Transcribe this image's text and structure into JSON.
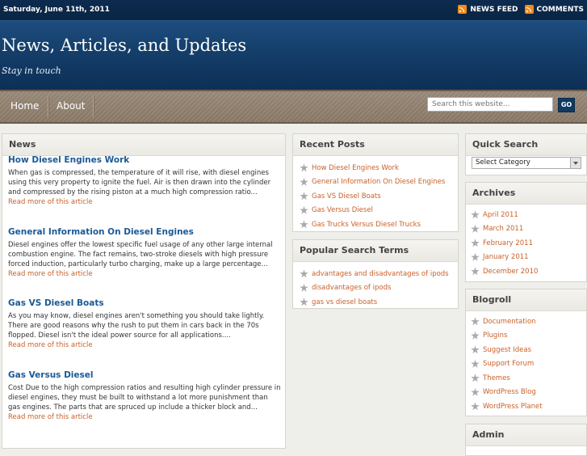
{
  "topbar": {
    "date": "Saturday, June 11th, 2011",
    "feeds": [
      "NEWS FEED",
      "COMMENTS"
    ]
  },
  "header": {
    "title": "News, Articles, and Updates",
    "tagline": "Stay in touch"
  },
  "nav": {
    "items": [
      "Home",
      "About"
    ],
    "search_placeholder": "Search this website...",
    "go_label": "GO"
  },
  "news": {
    "heading": "News",
    "posts": [
      {
        "title": "How Diesel Engines Work",
        "excerpt": "When gas is compressed, the temperature of it will rise, with diesel engines using this very property to ignite the fuel. Air is then drawn into the cylinder and compressed by the rising piston at a much high compression ratio...",
        "more": "Read more of this article"
      },
      {
        "title": "General Information On Diesel Engines",
        "excerpt": "Diesel engines offer the lowest specific fuel usage of any other large internal combustion engine. The fact remains, two-stroke diesels with high pressure forced induction, particularly turbo charging, make up a large percentage...",
        "more": "Read more of this article"
      },
      {
        "title": "Gas VS Diesel Boats",
        "excerpt": "As you may know, diesel engines aren't something you should take lightly. There are good reasons why the rush to put them in cars back in the 70s flopped. Diesel isn't the ideal power source for all applications....",
        "more": "Read more of this article"
      },
      {
        "title": "Gas Versus Diesel",
        "excerpt": "Cost Due to the high compression ratios and resulting high cylinder pressure in diesel engines, they must be built to withstand a lot more punishment than gas engines. The parts that are spruced up include a thicker block and...",
        "more": "Read more of this article"
      }
    ]
  },
  "recent": {
    "heading": "Recent Posts",
    "items": [
      "How Diesel Engines Work",
      "General Information On Diesel Engines",
      "Gas VS Diesel Boats",
      "Gas Versus Diesel",
      "Gas Trucks Versus Diesel Trucks"
    ]
  },
  "popular": {
    "heading": "Popular Search Terms",
    "items": [
      "advantages and disadvantages of ipods",
      "disadvantages of ipods",
      "gas vs diesel boats"
    ]
  },
  "quick": {
    "heading": "Quick Search",
    "select_value": "Select Category"
  },
  "archives": {
    "heading": "Archives",
    "items": [
      "April 2011",
      "March 2011",
      "February 2011",
      "January 2011",
      "December 2010"
    ]
  },
  "blogroll": {
    "heading": "Blogroll",
    "items": [
      "Documentation",
      "Plugins",
      "Suggest Ideas",
      "Support Forum",
      "Themes",
      "WordPress Blog",
      "WordPress Planet"
    ]
  },
  "admin": {
    "heading": "Admin"
  },
  "colors": {
    "link": "#1a5a96",
    "accent": "#c8612a",
    "header_bg": "#143e6a",
    "nav_bg": "#8f806f"
  }
}
